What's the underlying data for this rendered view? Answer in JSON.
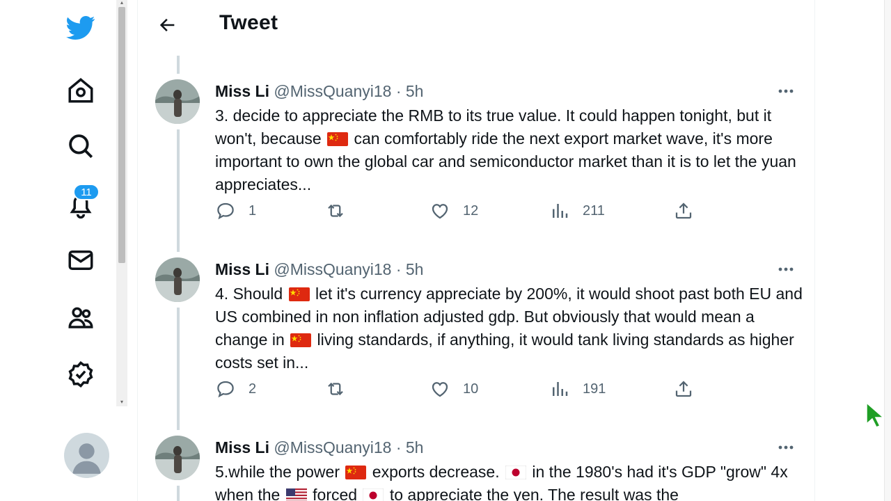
{
  "header": {
    "title": "Tweet"
  },
  "nav": {
    "notifications_badge": "11"
  },
  "tweets": [
    {
      "name": "Miss Li",
      "handle": "@MissQuanyi18",
      "sep": "·",
      "time": "5h",
      "segments": [
        "3. decide to appreciate the RMB to its true value. It could happen tonight, but it won't, because ",
        " can comfortably ride the next export market wave,  it's more important to own the global car and semiconductor market than it is to let the yuan appreciates..."
      ],
      "replies": "1",
      "likes": "12",
      "views": "211"
    },
    {
      "name": "Miss Li",
      "handle": "@MissQuanyi18",
      "sep": "·",
      "time": "5h",
      "segments": [
        "4. Should ",
        " let it's currency appreciate by 200%, it would shoot past both EU and US combined in non inflation adjusted gdp. But obviously that would mean a change in ",
        " living standards, if anything, it would tank living standards as higher costs set in..."
      ],
      "replies": "2",
      "likes": "10",
      "views": "191"
    },
    {
      "name": "Miss Li",
      "handle": "@MissQuanyi18",
      "sep": "·",
      "time": "5h",
      "segments": [
        "5.while the power ",
        " exports decrease. ",
        " in the 1980's had it's GDP \"grow\" 4x when the ",
        " forced ",
        " to appreciate the yen. The result was the"
      ]
    }
  ],
  "colors": {
    "accent": "#1d9bf0",
    "text": "#0f1419",
    "muted": "#536471"
  },
  "icons": [
    "twitter-logo-icon",
    "home-icon",
    "search-icon",
    "bell-icon",
    "mail-icon",
    "communities-icon",
    "verified-icon",
    "back-arrow-icon",
    "more-icon",
    "reply-icon",
    "retweet-icon",
    "like-icon",
    "views-icon",
    "share-icon",
    "china-flag-icon",
    "japan-flag-icon",
    "us-flag-icon"
  ]
}
